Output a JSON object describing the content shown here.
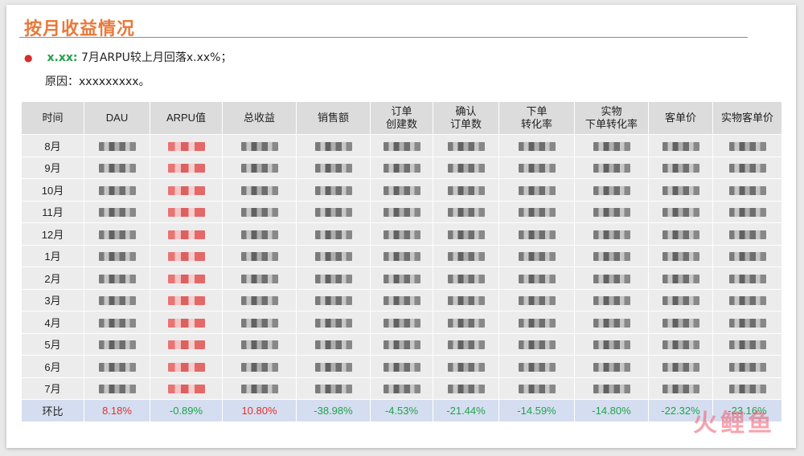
{
  "title": "按月收益情况",
  "summary": {
    "key": "x.xx:",
    "text": "7月ARPU较上月回落x.xx%；"
  },
  "reason": {
    "label": "原因：",
    "text": "xxxxxxxxx。"
  },
  "table": {
    "headers": [
      "时间",
      "DAU",
      "ARPU值",
      "总收益",
      "销售额",
      "订单\n创建数",
      "确认\n订单数",
      "下单\n转化率",
      "实物\n下单转化率",
      "客单价",
      "实物客单价"
    ],
    "rows": [
      {
        "month": "8月"
      },
      {
        "month": "9月"
      },
      {
        "month": "10月"
      },
      {
        "month": "11月"
      },
      {
        "month": "12月"
      },
      {
        "month": "1月"
      },
      {
        "month": "2月"
      },
      {
        "month": "3月"
      },
      {
        "month": "4月"
      },
      {
        "month": "5月"
      },
      {
        "month": "6月"
      },
      {
        "month": "7月"
      }
    ],
    "ratio_row": {
      "label": "环比",
      "values": [
        "8.18%",
        "-0.89%",
        "10.80%",
        "-38.98%",
        "-4.53%",
        "-21.44%",
        "-14.59%",
        "-14.80%",
        "-22.32%",
        "-23.16%"
      ]
    }
  },
  "watermark": "火鲤鱼",
  "colors": {
    "title": "#e8793a",
    "positive": "#e0322c",
    "negative": "#21a34a",
    "ratio_row_bg": "#d5def0"
  }
}
